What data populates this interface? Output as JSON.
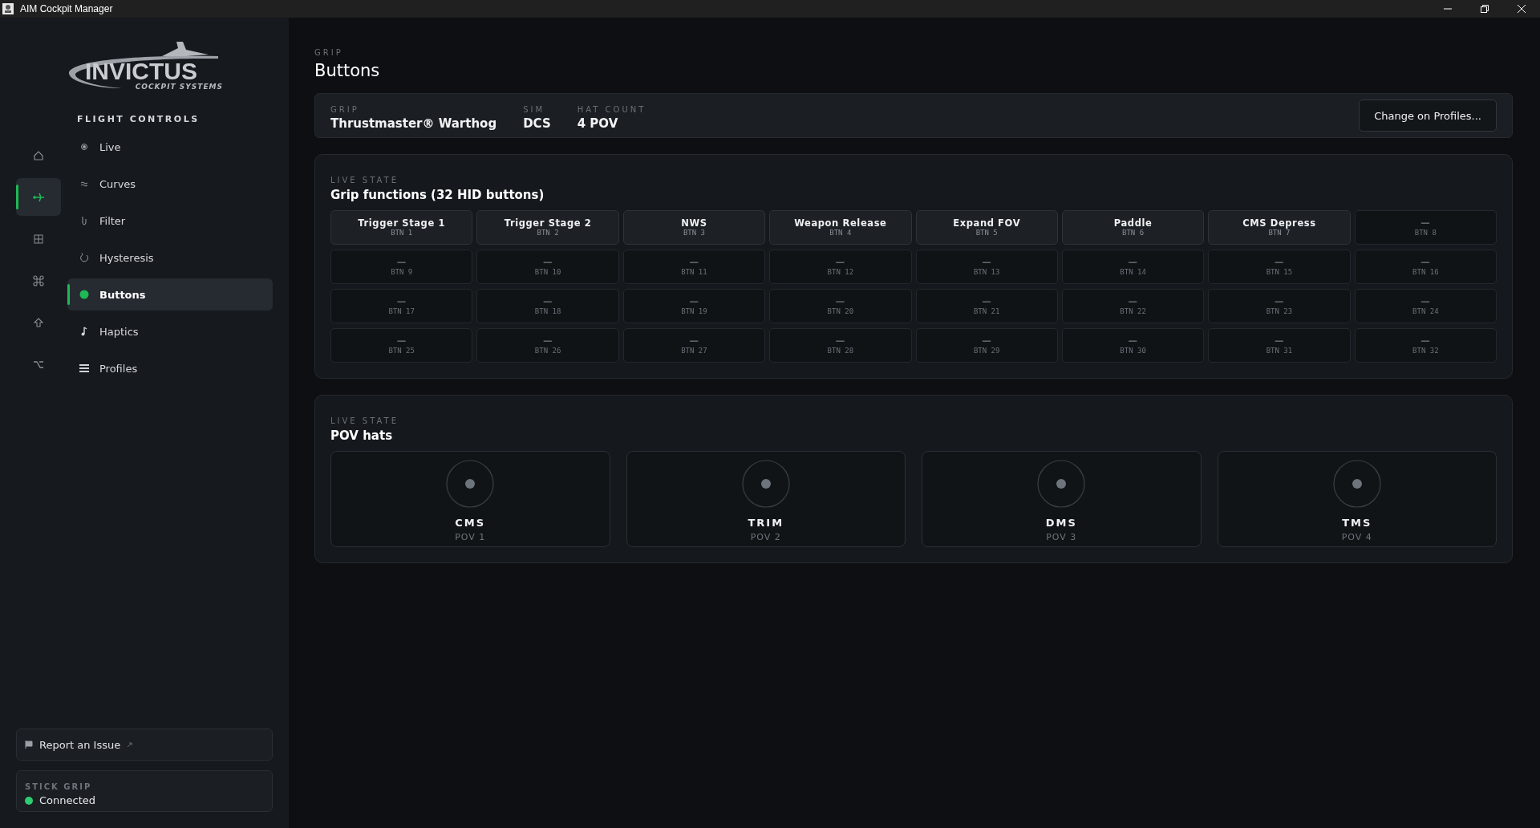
{
  "window": {
    "title": "AIM Cockpit Manager"
  },
  "sidebar": {
    "logo": {
      "name": "INVICTUS",
      "tagline": "COCKPIT SYSTEMS"
    },
    "rail": [
      {
        "selected": false
      },
      {
        "selected": true
      },
      {
        "selected": false
      },
      {
        "selected": false
      },
      {
        "selected": false
      },
      {
        "selected": false
      }
    ],
    "section": "FLIGHT CONTROLS",
    "items": [
      {
        "label": "Live",
        "selected": false
      },
      {
        "label": "Curves",
        "selected": false
      },
      {
        "label": "Filter",
        "selected": false
      },
      {
        "label": "Hysteresis",
        "selected": false
      },
      {
        "label": "Buttons",
        "selected": true
      },
      {
        "label": "Haptics",
        "selected": false
      },
      {
        "label": "Profiles",
        "selected": false
      }
    ],
    "report": {
      "label": "Report an Issue"
    },
    "status": {
      "label": "STICK GRIP",
      "value": "Connected",
      "color": "#2ecc71"
    }
  },
  "header": {
    "eyebrow": "GRIP",
    "title": "Buttons"
  },
  "info_bar": {
    "fields": [
      {
        "label": "GRIP",
        "value": "Thrustmaster® Warthog"
      },
      {
        "label": "SIM",
        "value": "DCS"
      },
      {
        "label": "HAT COUNT",
        "value": "4 POV"
      }
    ],
    "button": "Change on Profiles..."
  },
  "grip_panel": {
    "eyebrow": "LIVE STATE",
    "title": "Grip functions (32 HID buttons)",
    "buttons": [
      {
        "label": "Trigger Stage 1",
        "number": "BTN 1",
        "assigned": true
      },
      {
        "label": "Trigger Stage 2",
        "number": "BTN 2",
        "assigned": true
      },
      {
        "label": "NWS",
        "number": "BTN 3",
        "assigned": true
      },
      {
        "label": "Weapon Release",
        "number": "BTN 4",
        "assigned": true
      },
      {
        "label": "Expand FOV",
        "number": "BTN 5",
        "assigned": true
      },
      {
        "label": "Paddle",
        "number": "BTN 6",
        "assigned": true
      },
      {
        "label": "CMS Depress",
        "number": "BTN 7",
        "assigned": true
      },
      {
        "label": "—",
        "number": "BTN 8",
        "assigned": false
      },
      {
        "label": "—",
        "number": "BTN 9",
        "assigned": false
      },
      {
        "label": "—",
        "number": "BTN 10",
        "assigned": false
      },
      {
        "label": "—",
        "number": "BTN 11",
        "assigned": false
      },
      {
        "label": "—",
        "number": "BTN 12",
        "assigned": false
      },
      {
        "label": "—",
        "number": "BTN 13",
        "assigned": false
      },
      {
        "label": "—",
        "number": "BTN 14",
        "assigned": false
      },
      {
        "label": "—",
        "number": "BTN 15",
        "assigned": false
      },
      {
        "label": "—",
        "number": "BTN 16",
        "assigned": false
      },
      {
        "label": "—",
        "number": "BTN 17",
        "assigned": false
      },
      {
        "label": "—",
        "number": "BTN 18",
        "assigned": false
      },
      {
        "label": "—",
        "number": "BTN 19",
        "assigned": false
      },
      {
        "label": "—",
        "number": "BTN 20",
        "assigned": false
      },
      {
        "label": "—",
        "number": "BTN 21",
        "assigned": false
      },
      {
        "label": "—",
        "number": "BTN 22",
        "assigned": false
      },
      {
        "label": "—",
        "number": "BTN 23",
        "assigned": false
      },
      {
        "label": "—",
        "number": "BTN 24",
        "assigned": false
      },
      {
        "label": "—",
        "number": "BTN 25",
        "assigned": false
      },
      {
        "label": "—",
        "number": "BTN 26",
        "assigned": false
      },
      {
        "label": "—",
        "number": "BTN 27",
        "assigned": false
      },
      {
        "label": "—",
        "number": "BTN 28",
        "assigned": false
      },
      {
        "label": "—",
        "number": "BTN 29",
        "assigned": false
      },
      {
        "label": "—",
        "number": "BTN 30",
        "assigned": false
      },
      {
        "label": "—",
        "number": "BTN 31",
        "assigned": false
      },
      {
        "label": "—",
        "number": "BTN 32",
        "assigned": false
      }
    ]
  },
  "pov_panel": {
    "eyebrow": "LIVE STATE",
    "title": "POV hats",
    "hats": [
      {
        "name": "CMS",
        "number": "POV 1"
      },
      {
        "name": "TRIM",
        "number": "POV 2"
      },
      {
        "name": "DMS",
        "number": "POV 3"
      },
      {
        "name": "TMS",
        "number": "POV 4"
      }
    ]
  }
}
